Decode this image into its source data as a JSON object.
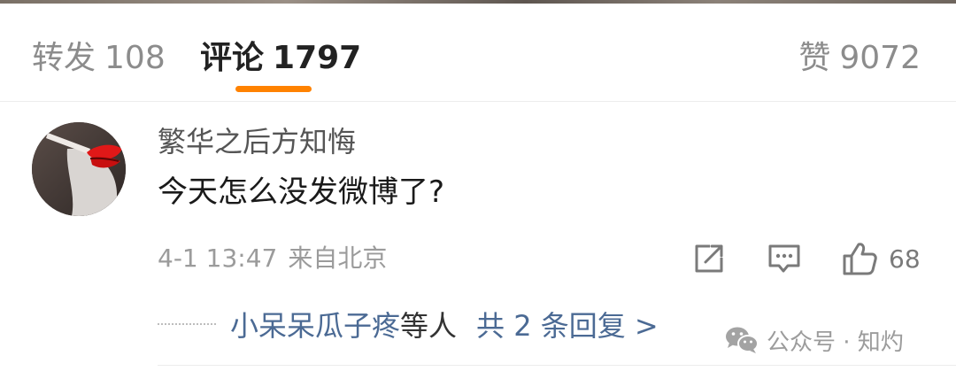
{
  "tabs": {
    "repost": {
      "label": "转发",
      "count": "108"
    },
    "comment": {
      "label": "评论",
      "count": "1797"
    },
    "like": {
      "label": "赞",
      "count": "9072"
    }
  },
  "accent_color": "#ff8200",
  "comment": {
    "username": "繁华之后方知悔",
    "text": "今天怎么没发微博了?",
    "date": "4-1 13:47",
    "location": "来自北京",
    "like_count": "68"
  },
  "replies": {
    "name": "小呆呆瓜子疼",
    "suffix": "等人",
    "total": "共 2 条回复 >"
  },
  "watermark": {
    "text": "公众号 · 知灼"
  },
  "icons": [
    "share-icon",
    "reply-icon",
    "like-icon",
    "wechat-icon"
  ]
}
